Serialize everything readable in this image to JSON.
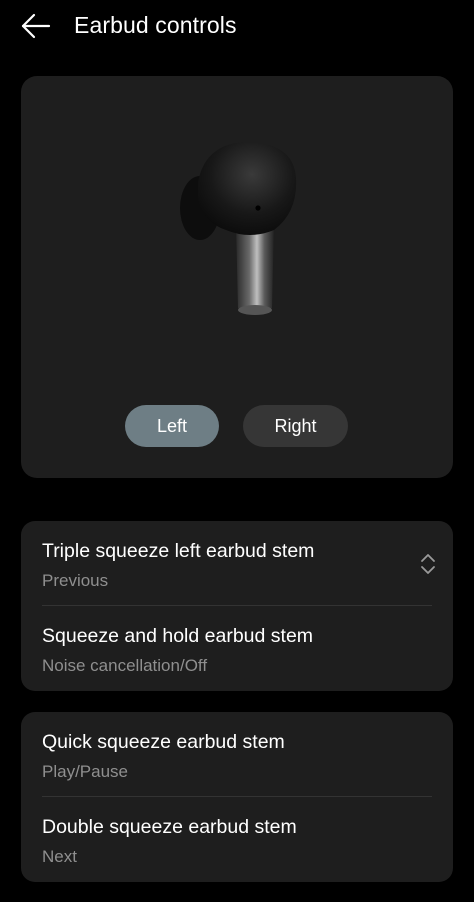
{
  "header": {
    "title": "Earbud controls",
    "back_icon": "arrow-left-icon"
  },
  "preview": {
    "image": "earbud-icon",
    "segments": [
      {
        "label": "Left",
        "selected": true
      },
      {
        "label": "Right",
        "selected": false
      }
    ]
  },
  "settings": {
    "groups": [
      {
        "items": [
          {
            "title": "Triple squeeze left earbud stem",
            "value": "Previous",
            "icon": "chevron-up-down-icon"
          },
          {
            "title": "Squeeze and hold earbud stem",
            "value": "Noise cancellation/Off"
          }
        ]
      },
      {
        "items": [
          {
            "title": "Quick squeeze earbud stem",
            "value": "Play/Pause"
          },
          {
            "title": "Double squeeze earbud stem",
            "value": "Next"
          }
        ]
      }
    ]
  },
  "colors": {
    "background": "#000000",
    "card": "#1e1e1e",
    "selected_segment": "#6e7e85",
    "unselected_segment": "#363636",
    "secondary_text": "#8f8f8f"
  }
}
